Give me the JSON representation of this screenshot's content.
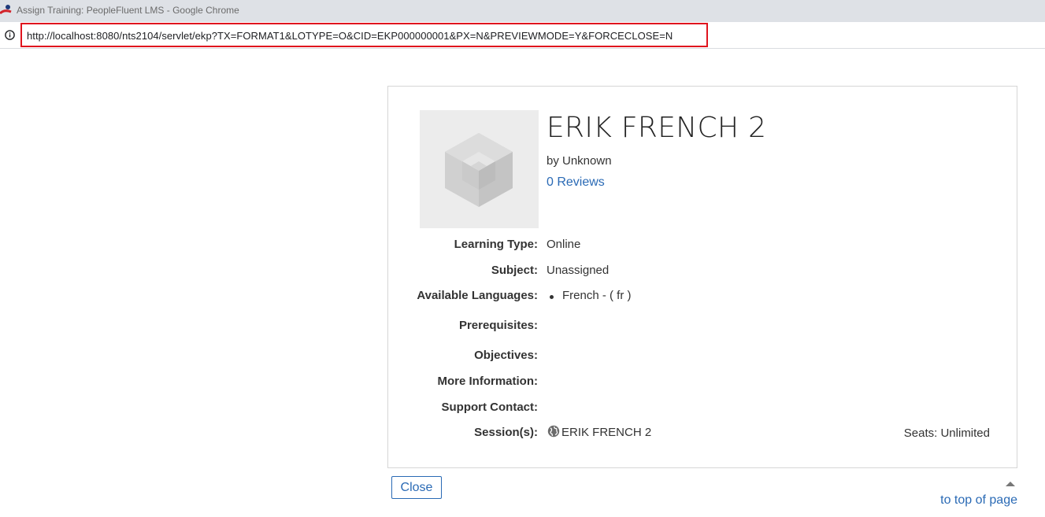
{
  "window": {
    "title": "Assign Training: PeopleFluent LMS - Google Chrome",
    "app_icon": "peoplefluent-logo-icon"
  },
  "addressbar": {
    "info_icon": "info-icon",
    "url": "http://localhost:8080/nts2104/servlet/ekp?TX=FORMAT1&LOTYPE=O&CID=EKP000000001&PX=N&PREVIEWMODE=Y&FORCECLOSE=N",
    "highlight_color": "#e0141e"
  },
  "course": {
    "thumbnail_icon": "cube-placeholder-icon",
    "title": "ERIK FRENCH 2",
    "byline": "by Unknown",
    "reviews_link": "0 Reviews",
    "fields": {
      "learning_type_label": "Learning Type:",
      "learning_type_value": "Online",
      "subject_label": "Subject:",
      "subject_value": "Unassigned",
      "languages_label": "Available Languages:",
      "languages": [
        "French - ( fr )"
      ],
      "prerequisites_label": "Prerequisites:",
      "objectives_label": "Objectives:",
      "more_info_label": "More Information:",
      "support_contact_label": "Support Contact:",
      "sessions_label": "Session(s):"
    },
    "session": {
      "icon": "globe-icon",
      "name": "ERIK FRENCH 2",
      "seats": "Seats: Unlimited"
    }
  },
  "footer": {
    "close_label": "Close",
    "top_link": "to top of page",
    "caret_icon": "caret-up-icon"
  },
  "colors": {
    "link": "#2a6ab5",
    "chrome_bar": "#dee1e6"
  }
}
